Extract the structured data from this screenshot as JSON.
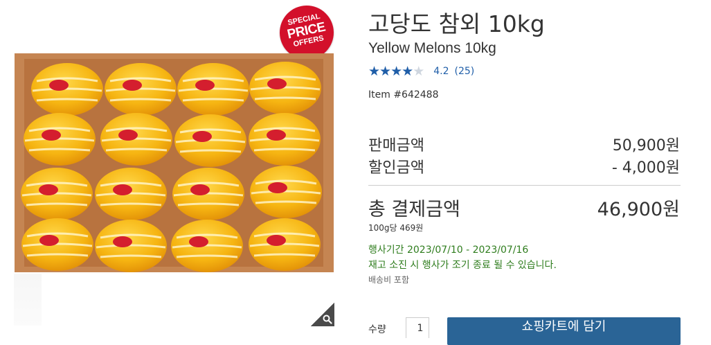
{
  "badge": {
    "line1": "SPECIAL",
    "line2": "PRICE",
    "line3": "OFFERS"
  },
  "product": {
    "title_ko": "고당도 참외 10kg",
    "title_en": "Yellow Melons 10kg",
    "rating_value": "4.2",
    "rating_stars": 4.2,
    "review_count": "(25)",
    "item_number": "Item #642488"
  },
  "pricing": {
    "sale_label": "판매금액",
    "sale_value": "50,900원",
    "discount_label": "할인금액",
    "discount_value": "- 4,000원",
    "total_label": "총 결제금액",
    "total_value": "46,900원",
    "unit_price": "100g당 469원"
  },
  "promo": {
    "period": "행사기간 2023/07/10 - 2023/07/16",
    "note": "재고 소진 시 행사가 조기 종료 될 수 있습니다."
  },
  "shipping": "배송비 포함",
  "purchase": {
    "qty_label": "수량",
    "qty_value": "1",
    "cart_button": "쇼핑카트에 담기"
  },
  "icons": {
    "zoom": "search-icon",
    "star": "star-icon"
  },
  "colors": {
    "accent_blue": "#1f5ea8",
    "button_blue": "#2a6496",
    "promo_green": "#2f7d1e",
    "badge_red": "#d3102b"
  }
}
